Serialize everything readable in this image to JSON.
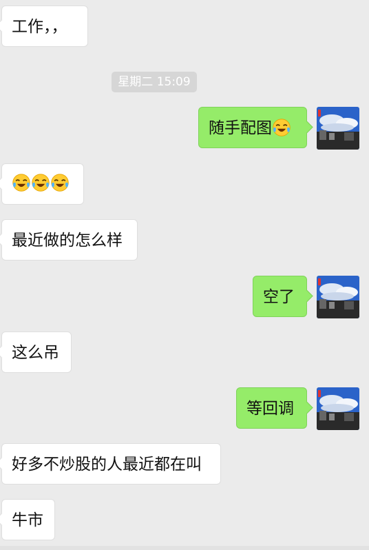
{
  "messages": [
    {
      "side": "left",
      "text": "工作，，"
    },
    {
      "type": "timestamp",
      "text": "星期二 15:09"
    },
    {
      "side": "right",
      "text": "随手配图",
      "emoji": "laughing-crying-emoji"
    },
    {
      "side": "left",
      "emoji": [
        "laughing-crying-emoji",
        "laughing-crying-emoji",
        "laughing-crying-emoji"
      ]
    },
    {
      "side": "left",
      "text": "最近做的怎么样"
    },
    {
      "side": "right",
      "text": "空了"
    },
    {
      "side": "left",
      "text": "这么吊"
    },
    {
      "side": "right",
      "text": "等回调"
    },
    {
      "side": "left",
      "text": "好多不炒股的人最近都在叫"
    },
    {
      "side": "left",
      "text": "牛市"
    }
  ],
  "colors": {
    "background": "#ebebeb",
    "bubble_left": "#ffffff",
    "bubble_right": "#95ec69",
    "timestamp_bg": "#d6d6d6"
  }
}
